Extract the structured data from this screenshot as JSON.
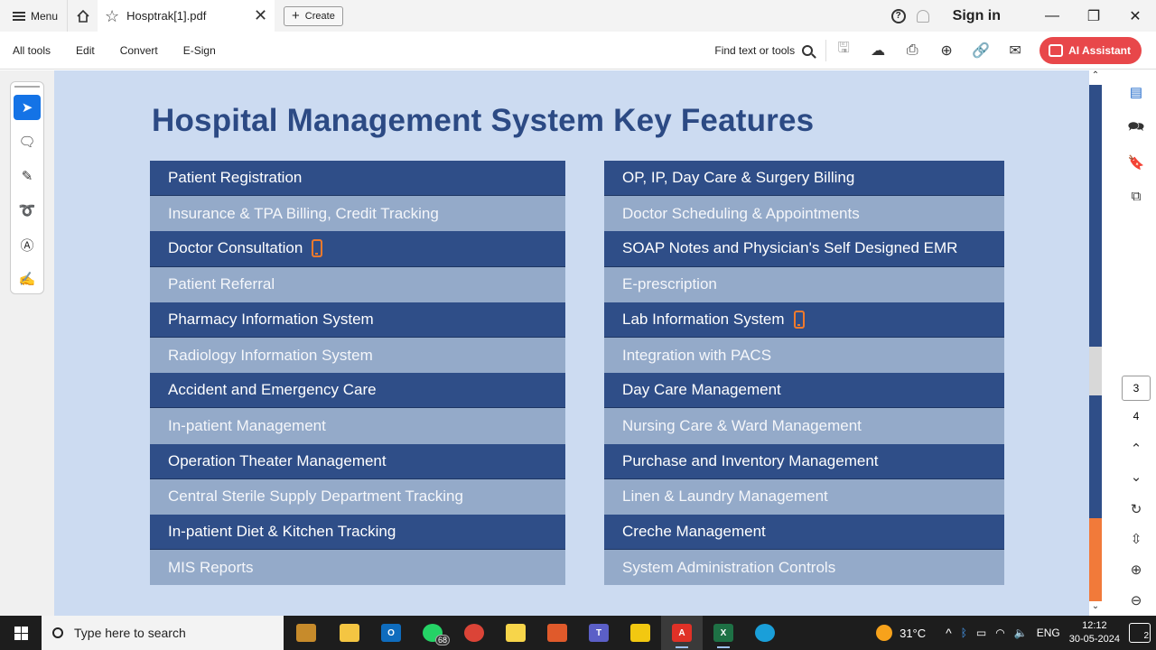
{
  "titlebar": {
    "menu_label": "Menu",
    "tab_title": "Hosptrak[1].pdf",
    "create_label": "Create",
    "signin_label": "Sign in"
  },
  "toolbar": {
    "menu": [
      "All tools",
      "Edit",
      "Convert",
      "E-Sign"
    ],
    "find_label": "Find text or tools",
    "ai_label": "AI Assistant"
  },
  "document": {
    "title": "Hospital Management System Key Features",
    "left_column": [
      {
        "label": "Patient Registration",
        "style": "dark",
        "mobile": false
      },
      {
        "label": "Insurance & TPA Billing, Credit Tracking",
        "style": "light",
        "mobile": false
      },
      {
        "label": "Doctor Consultation",
        "style": "dark",
        "mobile": true
      },
      {
        "label": "Patient Referral",
        "style": "light",
        "mobile": false
      },
      {
        "label": "Pharmacy Information System",
        "style": "dark",
        "mobile": false
      },
      {
        "label": "Radiology Information System",
        "style": "light",
        "mobile": false
      },
      {
        "label": "Accident and Emergency Care",
        "style": "dark",
        "mobile": false
      },
      {
        "label": "In-patient Management",
        "style": "light",
        "mobile": false
      },
      {
        "label": "Operation Theater Management",
        "style": "dark",
        "mobile": false
      },
      {
        "label": "Central Sterile Supply Department Tracking",
        "style": "light",
        "mobile": false
      },
      {
        "label": "In-patient Diet & Kitchen Tracking",
        "style": "dark",
        "mobile": false
      },
      {
        "label": "MIS Reports",
        "style": "light",
        "mobile": false
      }
    ],
    "right_column": [
      {
        "label": "OP, IP, Day Care & Surgery Billing",
        "style": "dark",
        "mobile": false
      },
      {
        "label": "Doctor Scheduling & Appointments",
        "style": "light",
        "mobile": false
      },
      {
        "label": "SOAP Notes and Physician's Self Designed EMR",
        "style": "dark",
        "mobile": false
      },
      {
        "label": "E-prescription",
        "style": "light",
        "mobile": false
      },
      {
        "label": "Lab Information System",
        "style": "dark",
        "mobile": true
      },
      {
        "label": "Integration with PACS",
        "style": "light",
        "mobile": false
      },
      {
        "label": "Day Care Management",
        "style": "dark",
        "mobile": false
      },
      {
        "label": "Nursing Care & Ward Management",
        "style": "light",
        "mobile": false
      },
      {
        "label": "Purchase and Inventory Management",
        "style": "dark",
        "mobile": false
      },
      {
        "label": "Linen & Laundry Management",
        "style": "light",
        "mobile": false
      },
      {
        "label": "Creche Management",
        "style": "dark",
        "mobile": false
      },
      {
        "label": "System Administration Controls",
        "style": "light",
        "mobile": false
      }
    ]
  },
  "right_panel": {
    "current_page": "3",
    "total_pages": "4"
  },
  "taskbar": {
    "search_placeholder": "Type here to search",
    "whatsapp_badge": "68",
    "temperature": "31°C",
    "language": "ENG",
    "time": "12:12",
    "date": "30-05-2024",
    "notifications": "2"
  },
  "colors": {
    "dark_row": "#2f4e88",
    "light_row": "#94aac9",
    "title": "#2c4a84",
    "doc_bg": "#ccdbf1",
    "ai_button": "#e8474a",
    "mobile_icon": "#f17a2c"
  }
}
